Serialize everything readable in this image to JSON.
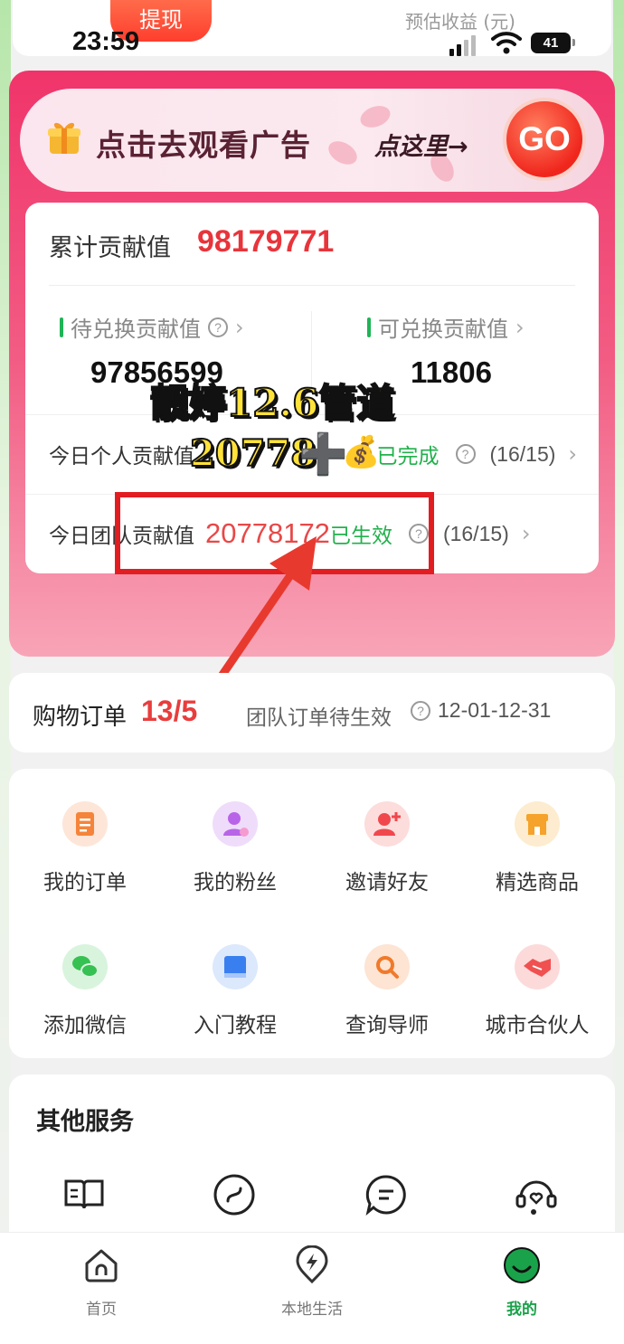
{
  "status_bar": {
    "time": "23:59",
    "battery": "41"
  },
  "top": {
    "withdraw_label": "提现",
    "estimated_income_label": "预估收益 (元)"
  },
  "ad_banner": {
    "text": "点击去观看广告",
    "hint": "点这里→",
    "go_label": "GO"
  },
  "contribution": {
    "cumulative_label": "累计贡献值",
    "cumulative_value": "98179771",
    "pending_label": "待兑换贡献值",
    "pending_value": "97856599",
    "redeemable_label": "可兑换贡献值",
    "redeemable_value": "11806",
    "today_personal_label": "今日个人贡献值",
    "today_personal_status": "已完成",
    "today_personal_progress": "(16/15)",
    "today_team_label": "今日团队贡献值",
    "today_team_value": "20778172",
    "today_team_status": "已生效",
    "today_team_progress": "(16/15)"
  },
  "overlay": {
    "title": "靓婷12.6管道",
    "number": "20778",
    "plus": "➕",
    "moneybag": "💰"
  },
  "orders": {
    "title": "购物订单",
    "count": "13/5",
    "pending": "团队订单待生效",
    "date_range": "12-01-12-31"
  },
  "grid": [
    {
      "label": "我的订单",
      "icon": "order-doc-icon",
      "color": "#f5843a"
    },
    {
      "label": "我的粉丝",
      "icon": "fans-icon",
      "color": "#b864e8"
    },
    {
      "label": "邀请好友",
      "icon": "invite-friend-icon",
      "color": "#f0474d"
    },
    {
      "label": "精选商品",
      "icon": "store-icon",
      "color": "#f5a32a"
    },
    {
      "label": "添加微信",
      "icon": "wechat-icon",
      "color": "#36c152"
    },
    {
      "label": "入门教程",
      "icon": "tutorial-book-icon",
      "color": "#3a7ff0"
    },
    {
      "label": "查询导师",
      "icon": "search-mentor-icon",
      "color": "#f07a2a"
    },
    {
      "label": "城市合伙人",
      "icon": "handshake-icon",
      "color": "#f05050"
    }
  ],
  "other_services": {
    "title": "其他服务"
  },
  "tabbar": [
    {
      "label": "首页",
      "icon": "home-icon"
    },
    {
      "label": "本地生活",
      "icon": "lightning-pin-icon"
    },
    {
      "label": "我的",
      "icon": "profile-icon"
    }
  ]
}
